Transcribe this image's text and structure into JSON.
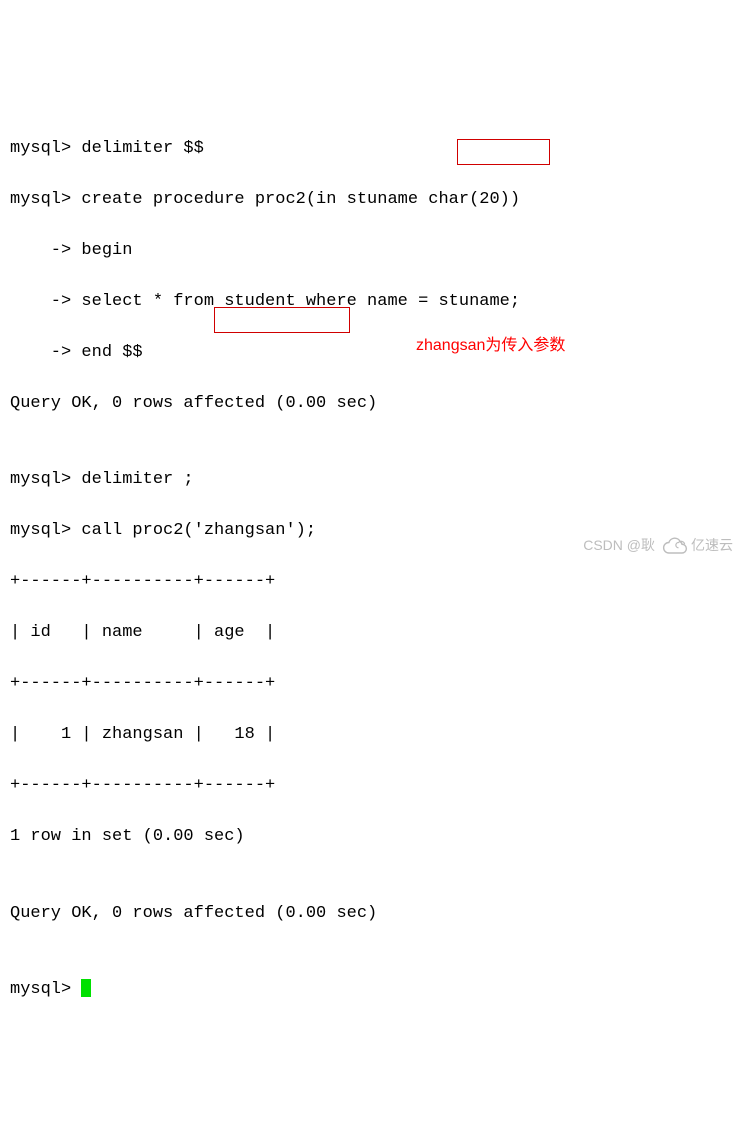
{
  "terminal": {
    "lines": [
      "mysql> delimiter $$",
      "mysql> create procedure proc2(in stuname char(20))",
      "    -> begin",
      "    -> select * from student where name = stuname;",
      "    -> end $$",
      "Query OK, 0 rows affected (0.00 sec)",
      "",
      "mysql> delimiter ;",
      "mysql> call proc2('zhangsan');",
      "+------+----------+------+",
      "| id   | name     | age  |",
      "+------+----------+------+",
      "|    1 | zhangsan |   18 |",
      "+------+----------+------+",
      "1 row in set (0.00 sec)",
      "",
      "Query OK, 0 rows affected (0.00 sec)",
      "",
      "mysql> "
    ]
  },
  "highlights": {
    "box1_text": "stuname;",
    "box2_text": "('zhangsan');"
  },
  "annotation": "zhangsan为传入参数",
  "watermark": {
    "text1": "CSDN @耿",
    "text2": "亿速云"
  }
}
